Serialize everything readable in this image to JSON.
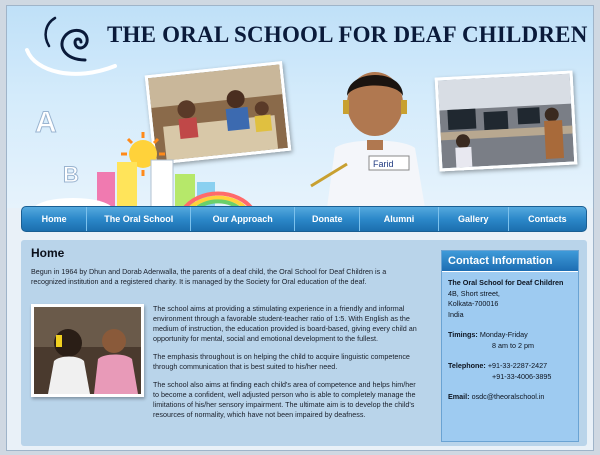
{
  "site": {
    "title": "THE ORAL SCHOOL FOR DEAF CHILDREN",
    "name_tag": "Farid"
  },
  "nav": {
    "items": [
      "Home",
      "The Oral School",
      "Our Approach",
      "Donate",
      "Alumni",
      "Gallery",
      "Contacts"
    ]
  },
  "main": {
    "heading": "Home",
    "intro": "Begun in 1964 by Dhun and Dorab Adenwalla, the parents of a deaf child, the Oral School for Deaf Children is a recognized institution and a registered charity. It is managed by the Society for Oral education of the deaf.",
    "paragraphs": [
      "The school aims at providing a stimulating experience in a friendly and informal environment through a favorable student-teacher ratio of 1:5. With English as the medium of instruction, the education provided is board-based, giving every child an opportunity for mental, social and emotional development to the fullest.",
      "The emphasis throughout is on helping the child to acquire linguistic competence through communication that is best suited to his/her need.",
      "The school also aims at finding each child's area of competence and helps him/her to become a confident, well adjusted person who is able to completely manage the limitations of his/her sensory impairment. The ultimate aim is to develop the child's resources of normality, which have not been impaired by deafness."
    ]
  },
  "contact": {
    "heading": "Contact Information",
    "org": "The Oral School for Deaf Children",
    "address": [
      "4B, Short street,",
      "Kolkata-700016",
      "India"
    ],
    "timings_label": "Timings:",
    "timings_days": "Monday-Friday",
    "timings_hours": "8 am to 2 pm",
    "telephone_label": "Telephone:",
    "telephone_1": "+91-33-2287-2427",
    "telephone_2": "+91-33-4006-3895",
    "email_label": "Email:",
    "email": "osdc@theoralschool.in"
  }
}
